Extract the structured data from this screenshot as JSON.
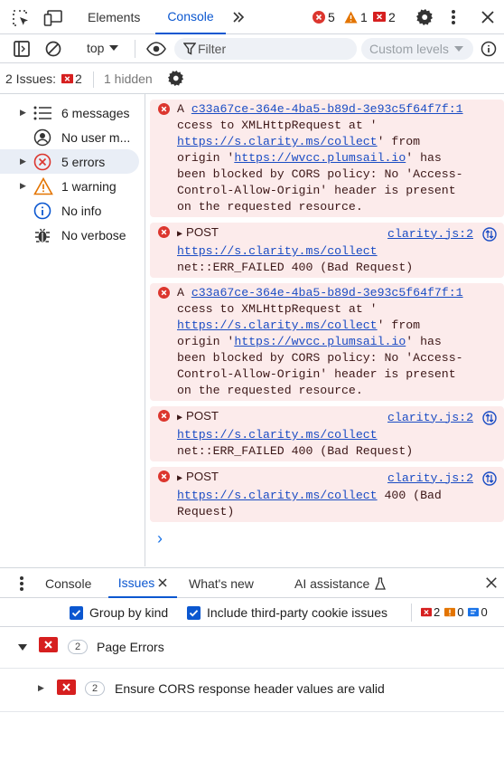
{
  "topbar": {
    "tabs": [
      {
        "label": "Elements"
      },
      {
        "label": "Console"
      }
    ],
    "more_tabs_icon": "chevrons-right-icon",
    "error_count": "5",
    "warning_count": "1",
    "issue_count": "2"
  },
  "toolbar": {
    "context": "top",
    "filter_placeholder": "Filter",
    "levels": "Custom levels"
  },
  "issues_bar": {
    "label": "2 Issues:",
    "count": "2",
    "hidden": "1 hidden"
  },
  "sidebar": {
    "items": [
      {
        "label": "6 messages",
        "icon": "list-icon"
      },
      {
        "label": "No user m...",
        "icon": "user-icon"
      },
      {
        "label": "5 errors",
        "icon": "error-icon"
      },
      {
        "label": "1 warning",
        "icon": "warning-icon"
      },
      {
        "label": "No info",
        "icon": "info-icon"
      },
      {
        "label": "No verbose",
        "icon": "bug-icon"
      }
    ]
  },
  "console": {
    "messages": [
      {
        "line1_prefix": "A ",
        "line1_link": "c33a67ce-364e-4ba5-b89d-3e93c5f64f7f:1",
        "line2": "ccess to XMLHttpRequest at '",
        "line3_link": "https://s.clarity.ms/collect",
        "line3_suffix": "' from",
        "line4_prefix": "origin '",
        "line4_link": "https://wvcc.plumsail.io",
        "line4_suffix": "' has",
        "line5": "been blocked by CORS policy: No 'Access-",
        "line6": "Control-Allow-Origin' header is present",
        "line7": "on the requested resource."
      },
      {
        "method": "POST",
        "source": "clarity.js:2",
        "url": "https://s.clarity.ms/collect",
        "detail": "net::ERR_FAILED 400 (Bad Request)"
      },
      {
        "line1_prefix": "A ",
        "line1_link": "c33a67ce-364e-4ba5-b89d-3e93c5f64f7f:1",
        "line2": "ccess to XMLHttpRequest at '",
        "line3_link": "https://s.clarity.ms/collect",
        "line3_suffix": "' from",
        "line4_prefix": "origin '",
        "line4_link": "https://wvcc.plumsail.io",
        "line4_suffix": "' has",
        "line5": "been blocked by CORS policy: No 'Access-",
        "line6": "Control-Allow-Origin' header is present",
        "line7": "on the requested resource."
      },
      {
        "method": "POST",
        "source": "clarity.js:2",
        "url": "https://s.clarity.ms/collect",
        "detail": "net::ERR_FAILED 400 (Bad Request)"
      },
      {
        "method": "POST",
        "source": "clarity.js:2",
        "url": "https://s.clarity.ms/collect",
        "url_suffix": " 400 (Bad",
        "detail": "Request)"
      }
    ],
    "prompt": "›"
  },
  "drawer": {
    "tabs": [
      {
        "label": "Console"
      },
      {
        "label": "Issues"
      },
      {
        "label": "What's new"
      },
      {
        "label": "AI assistance"
      }
    ],
    "group_by_kind": "Group by kind",
    "include_third_party": "Include third-party cookie issues",
    "errors": "2",
    "warnings": "0",
    "infos": "0",
    "group": {
      "count": "2",
      "label": "Page Errors"
    },
    "issue": {
      "count": "2",
      "label": "Ensure CORS response header values are valid"
    }
  },
  "colors": {
    "accent": "#0b57d0",
    "error": "#dc362e",
    "error_bg": "#fcebeb",
    "warning": "#e37400"
  }
}
